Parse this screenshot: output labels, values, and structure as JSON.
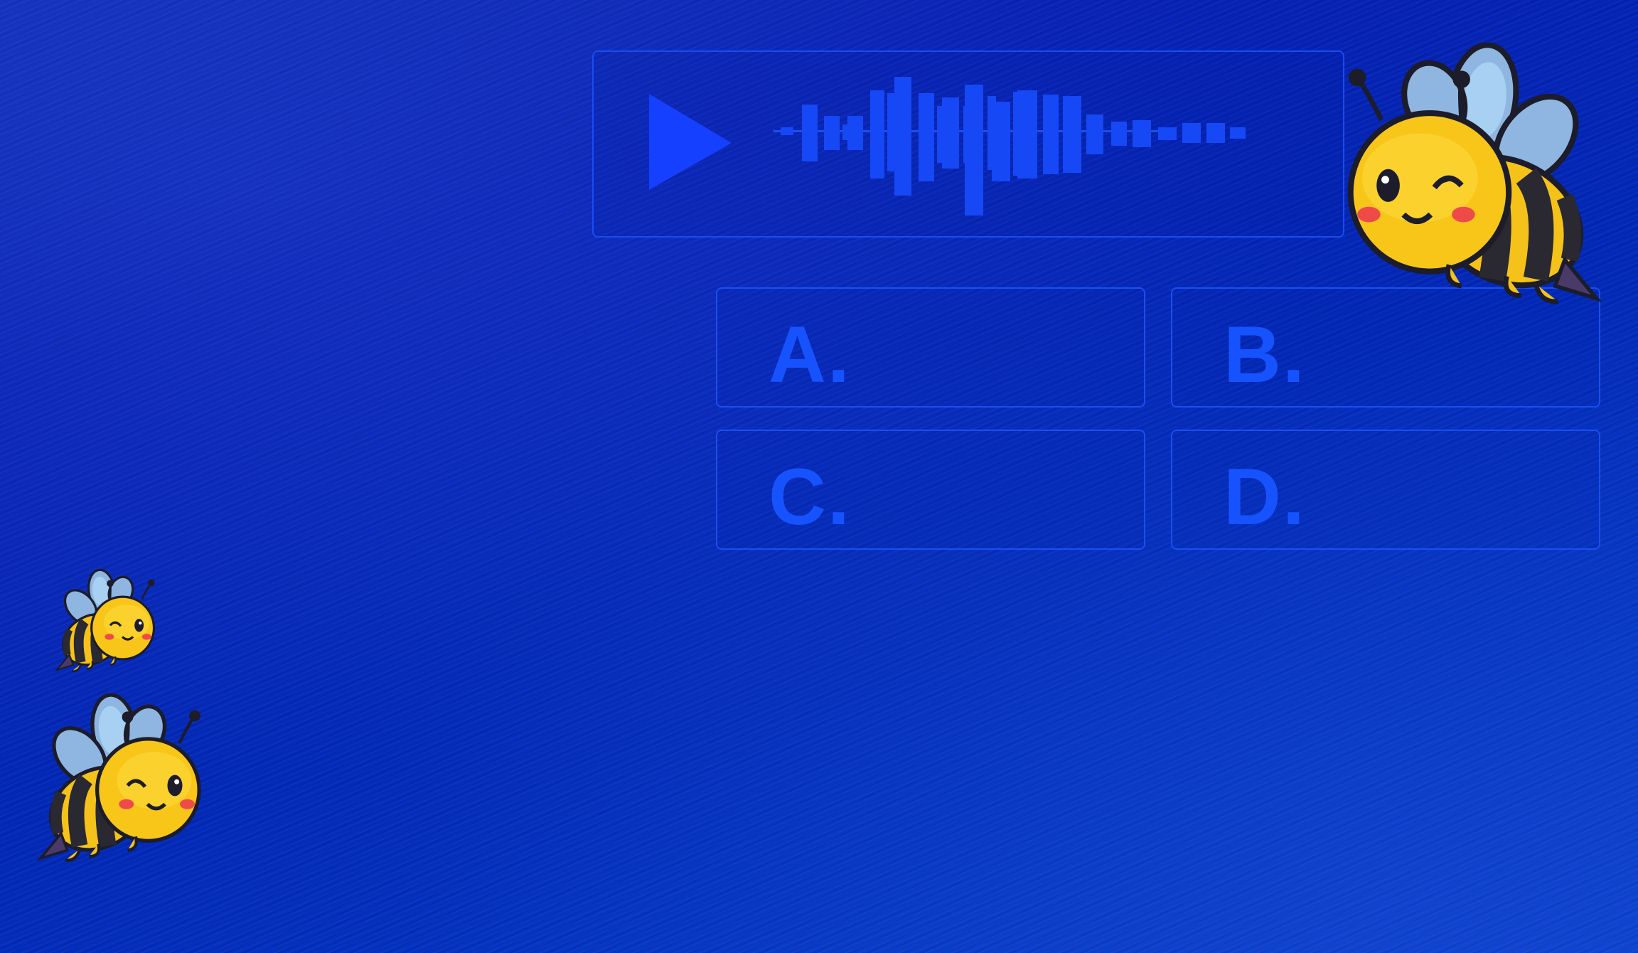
{
  "audio_player": {
    "play_icon": "play-icon",
    "waveform_icon": "waveform-icon",
    "accent_color": "#1448ff"
  },
  "options": [
    {
      "letter": "A.",
      "text": ""
    },
    {
      "letter": "B.",
      "text": ""
    },
    {
      "letter": "C.",
      "text": ""
    },
    {
      "letter": "D.",
      "text": ""
    }
  ],
  "decorations": [
    "bee-mascot",
    "bee-mascot",
    "bee-mascot"
  ]
}
